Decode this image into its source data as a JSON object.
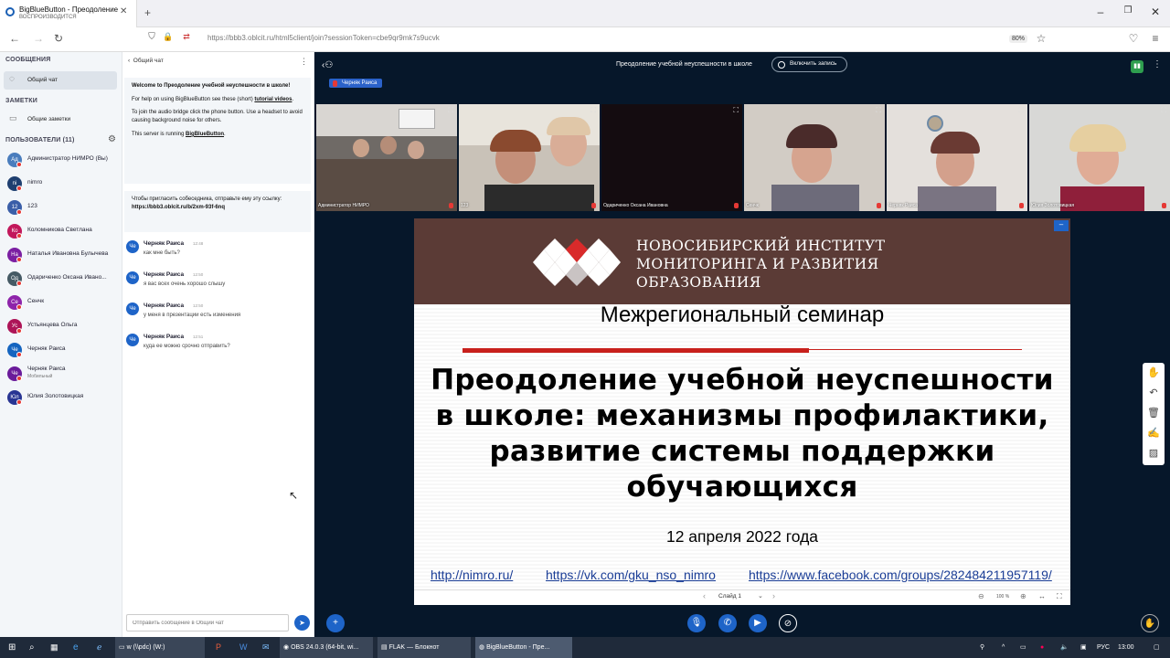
{
  "browser": {
    "tab_title": "BigBlueButton - Преодоление",
    "tab_subtitle": "ВОСПРОИЗВОДИТСЯ",
    "new_tab": "+",
    "url": "https://bbb3.oblcit.ru/html5client/join?sessionToken=cbe9qr9mk7s9ucvk",
    "zoom": "80%"
  },
  "left": {
    "messages_header": "СООБЩЕНИЯ",
    "public_chat": "Общий чат",
    "notes_header": "ЗАМЕТКИ",
    "shared_notes": "Общие заметки",
    "users_header": "ПОЛЬЗОВАТЕЛИ (11)",
    "users": [
      {
        "initials": "Ад",
        "name": "Администратор НИМРО (Вы)",
        "color": "#4a7dbd"
      },
      {
        "initials": "ni",
        "name": "nimro",
        "color": "#1f3f70"
      },
      {
        "initials": "12",
        "name": "123",
        "color": "#3a5ea8"
      },
      {
        "initials": "Ко",
        "name": "Коломникова Светлана",
        "color": "#c2185b"
      },
      {
        "initials": "На",
        "name": "Наталья Ивановна Булычева",
        "color": "#7b1fa2"
      },
      {
        "initials": "Од",
        "name": "Одариченко Оксана Ивано...",
        "color": "#455a64"
      },
      {
        "initials": "Се",
        "name": "Сенчк",
        "color": "#8e24aa"
      },
      {
        "initials": "Ус",
        "name": "Устьянцева Ольга",
        "color": "#ad1457"
      },
      {
        "initials": "Че",
        "name": "Черняк Раиса",
        "color": "#1565c0"
      },
      {
        "initials": "Че",
        "name": "Черняк Раиса",
        "sub": "Мобильный",
        "color": "#6a1b9a"
      },
      {
        "initials": "Юл",
        "name": "Юлия Золотовицкая",
        "color": "#283593"
      }
    ]
  },
  "chat": {
    "header": "Общий чат",
    "welcome_pre": "Welcome to ",
    "welcome_bold": "Преодоление учебной неуспешности в школе!",
    "help_pre": "For help on using BigBlueButton see these (short) ",
    "help_link": "tutorial videos",
    "help_post": ".",
    "audio": "To join the audio bridge click the phone button. Use a headset to avoid causing background noise for others.",
    "running_pre": "This server is running ",
    "running_link": "BigBlueButton",
    "running_post": ".",
    "invite": "Чтобы пригласить собеседника, отправьте ему эту ссылку:",
    "invite_link": "https://bbb3.oblcit.ru/b/2xm-93f-6nq",
    "messages": [
      {
        "author": "Черняк Раиса",
        "time": "12:48",
        "text": "как мне быть?"
      },
      {
        "author": "Черняк Раиса",
        "time": "12:50",
        "text": "я вас всех очень хорошо слышу"
      },
      {
        "author": "Черняк Раиса",
        "time": "12:50",
        "text": "у меня в презентации есть изменения"
      },
      {
        "author": "Черняк Раиса",
        "time": "12:51",
        "text": "куда ее можно срочно отправить?"
      }
    ],
    "input_placeholder": "Отправить сообщение в Общий чат"
  },
  "meeting": {
    "title": "Преодоление учебной неуспешности в школе",
    "record": "Включить запись",
    "talking": "Черняк Раиса",
    "videos": [
      {
        "name": "Администратор НИМРО"
      },
      {
        "name": "123"
      },
      {
        "name": "Одариченко Оксана Ивановна"
      },
      {
        "name": "Сенчк"
      },
      {
        "name": "Черняк Раиса"
      },
      {
        "name": "Юлия Золотовицкая"
      }
    ]
  },
  "slide": {
    "institute_l1": "НОВОСИБИРСКИЙ ИНСТИТУТ",
    "institute_l2": "МОНИТОРИНГА И РАЗВИТИЯ",
    "institute_l3": "ОБРАЗОВАНИЯ",
    "seminar": "Межрегиональный семинар",
    "title_l1": "Преодоление учебной неуспешности",
    "title_l2": "в школе: механизмы профилактики,",
    "title_l3": "развитие системы поддержки",
    "title_l4": "обучающихся",
    "date": "12 апреля 2022 года",
    "link1": "http://nimro.ru/",
    "link2": "https://vk.com/gku_nso_nimro",
    "link3": "https://www.facebook.com/groups/282484211957119/",
    "slide_label": "Слайд 1",
    "zoom": "100 %"
  },
  "taskbar": {
    "item1": "w (\\\\pdc) (W:)",
    "item2": "OBS 24.0.3 (64-bit, wi...",
    "item3": "FLAK — Блокнот",
    "item4": "BigBlueButton - Пре...",
    "lang": "РУС",
    "time": "13:00"
  },
  "colors": {
    "accent": "#1e64c8",
    "main_bg": "#06172a",
    "slide_header": "#5b3b36",
    "slide_red": "#c8201c"
  }
}
